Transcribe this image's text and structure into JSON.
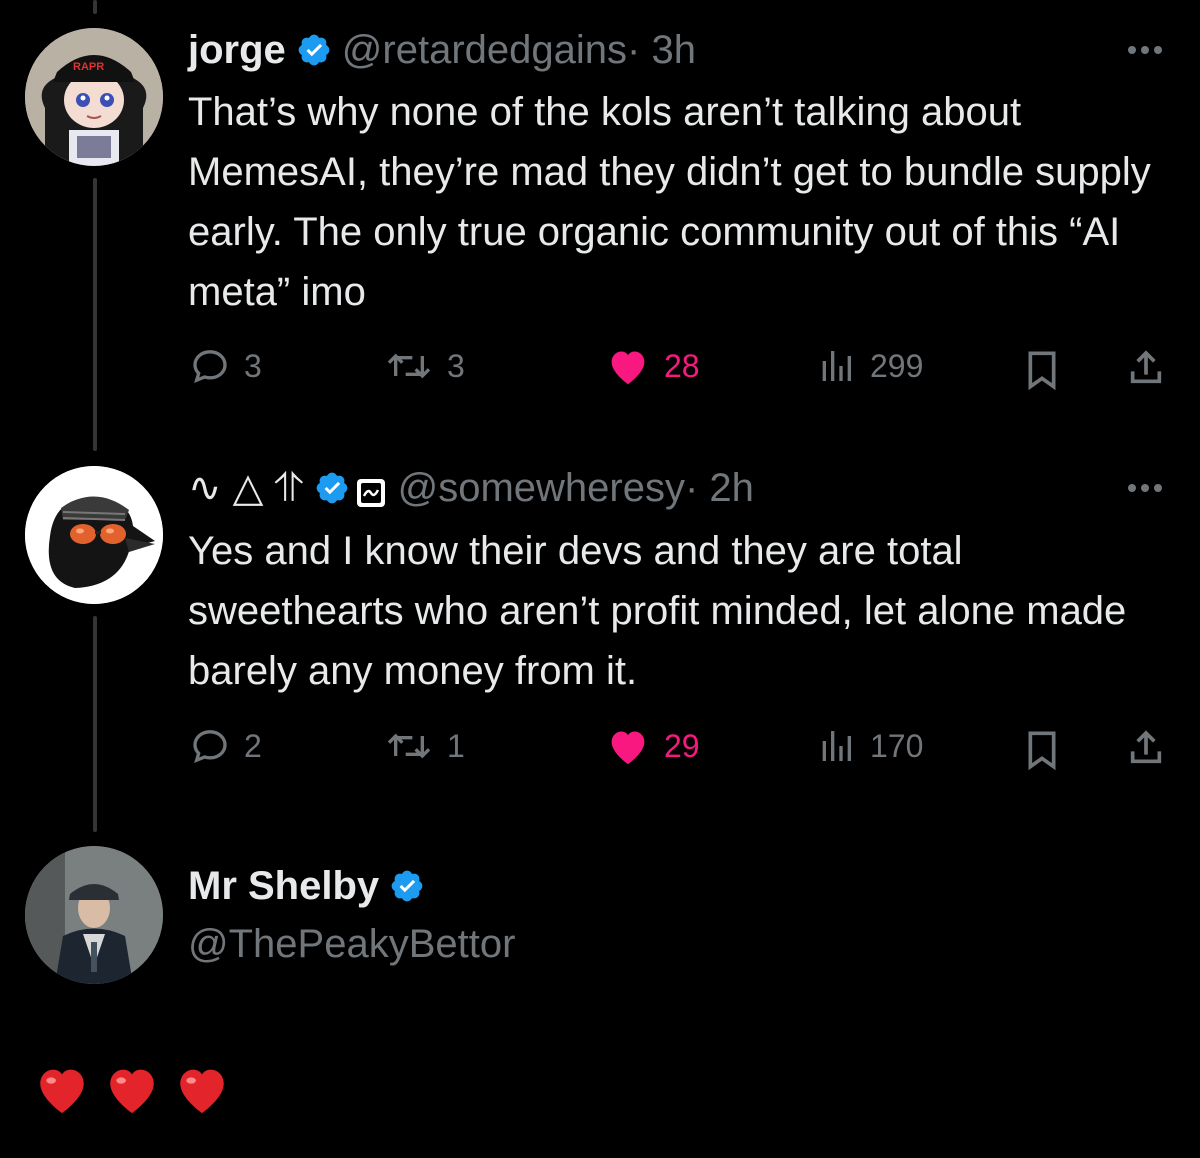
{
  "tweets": [
    {
      "name": "jorge",
      "handle": "@retardedgains",
      "time": "· 3h",
      "avatar_cap_text": "RAPR",
      "text": "That’s why none of the kols aren’t talking about MemesAI, they’re mad they didn’t get to bundle supply early. The only true organic community out of this “AI meta” imo",
      "replies": "3",
      "retweets": "3",
      "likes": "28",
      "views": "299"
    },
    {
      "name": "∿ △ ⥣",
      "handle": "@somewheresy",
      "time": "· 2h",
      "text": "Yes and I know their devs and they are total sweethearts who aren’t profit minded, let alone made barely any money from it.",
      "replies": "2",
      "retweets": "1",
      "likes": "29",
      "views": "170"
    }
  ],
  "compose": {
    "name": "Mr Shelby",
    "handle": "@ThePeakyBettor",
    "reply_text": "❤️❤️❤️"
  },
  "colors": {
    "background": "#000000",
    "text": "#e7e9ea",
    "muted": "#71767b",
    "verified": "#1d9bf0",
    "like": "#f91880"
  },
  "icons": [
    "verified-badge-icon",
    "more-icon",
    "reply-icon",
    "retweet-icon",
    "heart-icon",
    "views-icon",
    "bookmark-icon",
    "share-icon",
    "label-icon"
  ]
}
